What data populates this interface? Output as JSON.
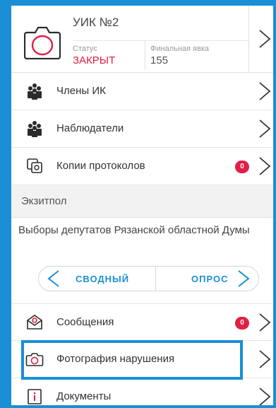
{
  "header": {
    "uik_title": "УИК №2",
    "status_label": "Статус",
    "status_value": "ЗАКРЫТ",
    "final_turnout_label": "Финальная явка",
    "final_turnout_value": "155"
  },
  "menu": {
    "members": {
      "label": "Члены ИК",
      "icon": "group-icon"
    },
    "observers": {
      "label": "Наблюдатели",
      "icon": "group-icon"
    },
    "protocol_copies": {
      "label": "Копии протоколов",
      "badge": "0",
      "icon": "copy-icon"
    }
  },
  "exitpoll": {
    "section_label": "Экзитпол",
    "elections_title": "Выборы депутатов Рязанской областной Думы",
    "tab_summary": "СВОДНЫЙ",
    "tab_poll": "ОПРОС"
  },
  "menu2": {
    "messages": {
      "label": "Сообщения",
      "badge": "0",
      "icon": "message-icon"
    },
    "violation_photo": {
      "label": "Фотография нарушения",
      "icon": "camera-icon"
    },
    "documents": {
      "label": "Документы",
      "icon": "info-icon"
    }
  },
  "colors": {
    "accent": "#1a8fd6",
    "alert": "#e02045"
  }
}
